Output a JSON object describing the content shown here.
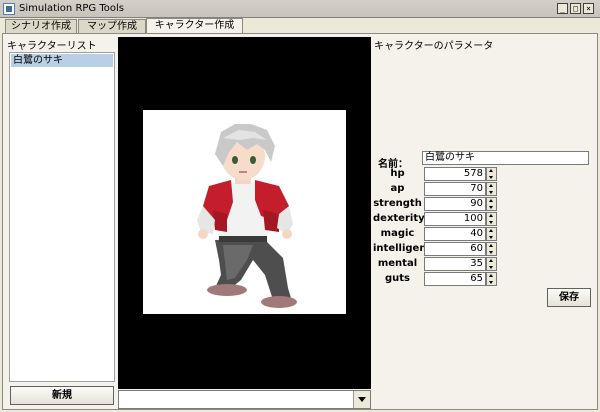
{
  "window": {
    "title": "Simulation RPG Tools",
    "minimize_glyph": "_",
    "maximize_glyph": "□",
    "close_glyph": "×"
  },
  "tabs": [
    {
      "label": "シナリオ作成"
    },
    {
      "label": "マップ作成"
    },
    {
      "label": "キャラクター作成"
    }
  ],
  "left_panel": {
    "title": "キャラクターリスト",
    "items": [
      {
        "label": "白鷺のサキ"
      }
    ],
    "new_button": "新規"
  },
  "right_panel": {
    "title": "キャラクターのパラメータ",
    "name_label": "名前：",
    "name_value": "白鷺のサキ",
    "stats": [
      {
        "label": "hp",
        "value": "578"
      },
      {
        "label": "ap",
        "value": "70"
      },
      {
        "label": "strength",
        "value": "90"
      },
      {
        "label": "dexterity",
        "value": "100"
      },
      {
        "label": "magic",
        "value": "40"
      },
      {
        "label": "intelligence",
        "value": "60"
      },
      {
        "label": "mental",
        "value": "35"
      },
      {
        "label": "guts",
        "value": "65"
      }
    ],
    "save_button": "保存"
  }
}
